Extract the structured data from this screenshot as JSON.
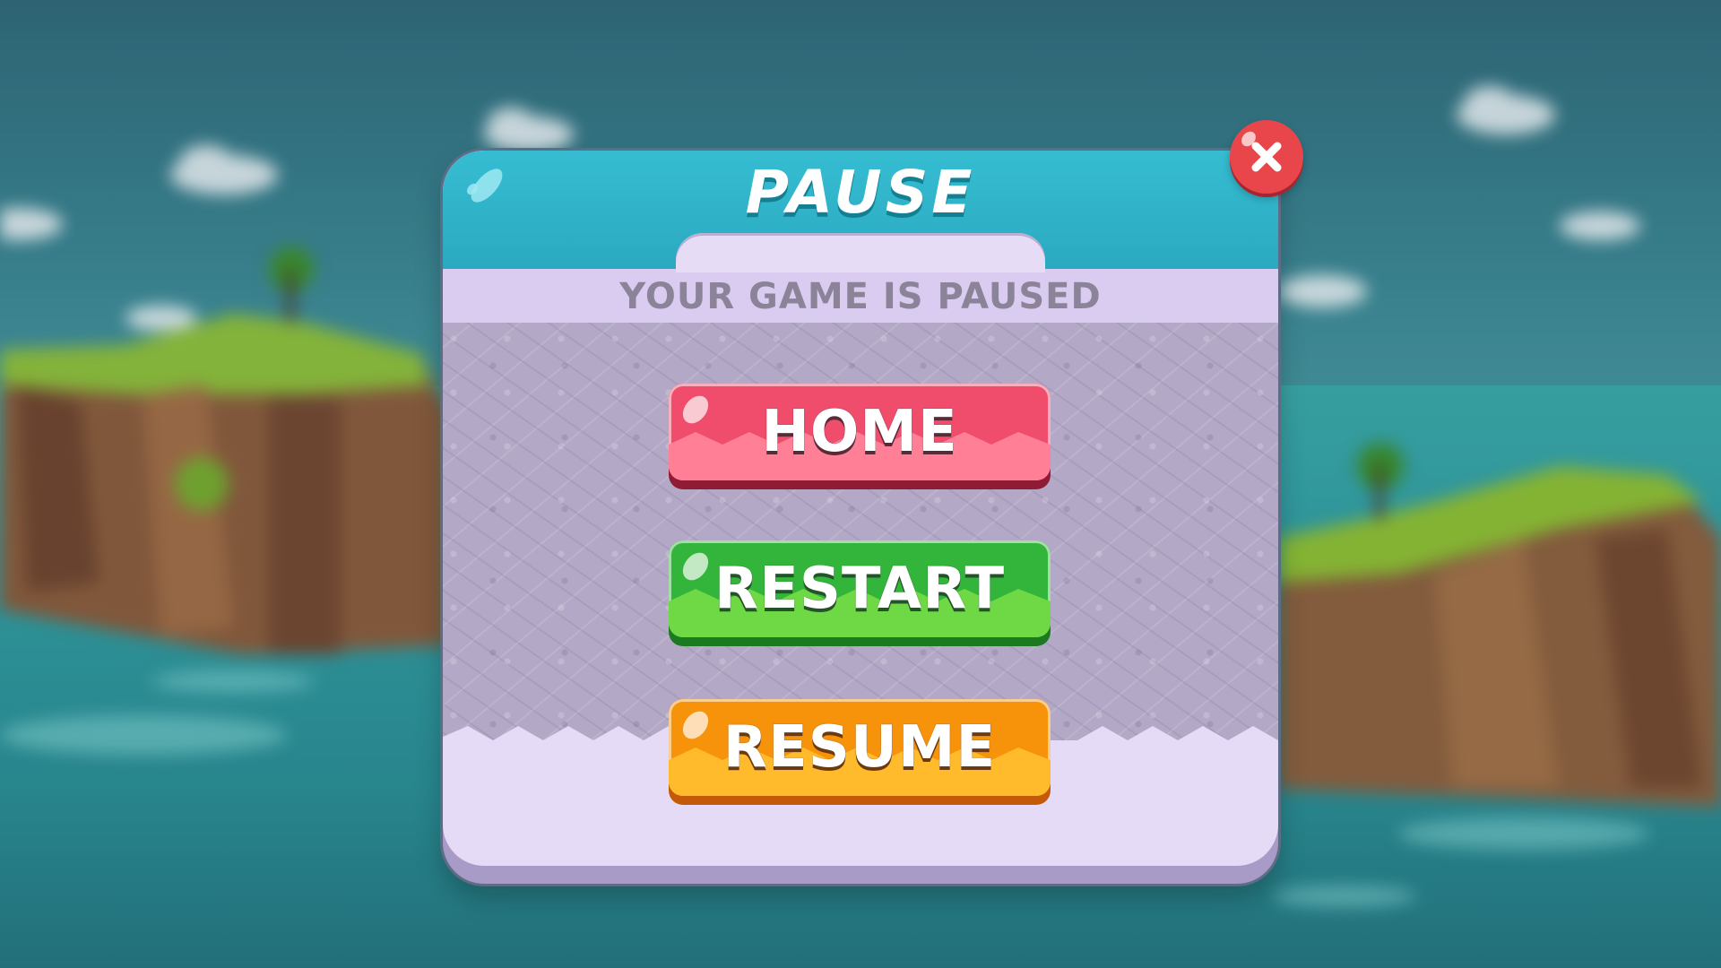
{
  "dialog": {
    "title": "PAUSE",
    "subtitle": "YOUR GAME IS PAUSED"
  },
  "buttons": {
    "home": "HOME",
    "restart": "RESTART",
    "resume": "RESUME"
  },
  "icons": {
    "close": "close-icon"
  },
  "colors": {
    "header": "#2aa9c0",
    "home": "#ef4d6b",
    "restart": "#32b53a",
    "resume": "#f7920b",
    "close": "#e9464c",
    "panel": "#e6dbf6"
  }
}
